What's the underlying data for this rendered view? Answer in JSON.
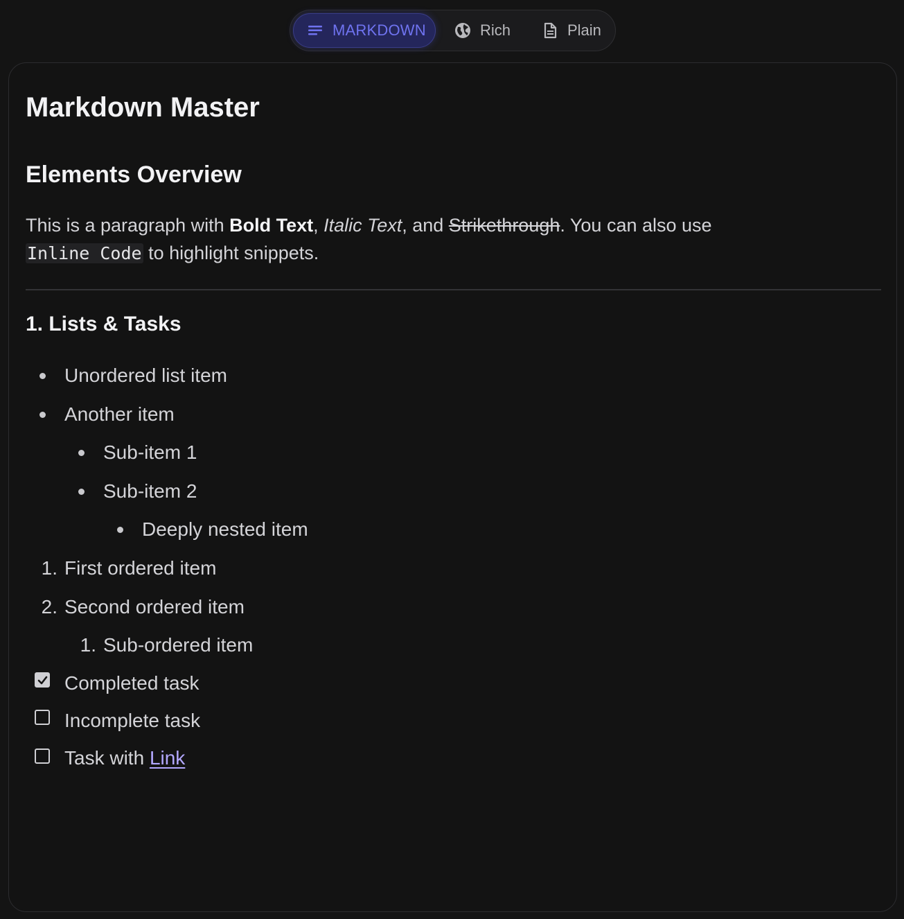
{
  "modes": {
    "markdown": {
      "label": "MARKDOWN",
      "icon": "lines-icon",
      "active": true
    },
    "rich": {
      "label": "Rich",
      "icon": "globe-icon"
    },
    "plain": {
      "label": "Plain",
      "icon": "document-icon"
    }
  },
  "doc": {
    "title": "Markdown Master",
    "section_title": "Elements Overview",
    "paragraph": {
      "p1": "This is a paragraph with ",
      "bold": "Bold Text",
      "p2": ", ",
      "italic": "Italic Text",
      "p3": ", and ",
      "strike": "Strikethrough",
      "p4": ". You can also use",
      "code": "Inline Code",
      "p5": " to highlight snippets."
    },
    "lists_title": "1. Lists & Tasks",
    "unordered": [
      "Unordered list item",
      "Another item",
      "Sub-item 1",
      "Sub-item 2",
      "Deeply nested item"
    ],
    "ordered": [
      {
        "num": "1.",
        "text": "First ordered item"
      },
      {
        "num": "2.",
        "text": "Second ordered item"
      },
      {
        "num": "1.",
        "text": "Sub-ordered item"
      }
    ],
    "tasks": [
      {
        "text": "Completed task",
        "checked": true
      },
      {
        "text": "Incomplete task",
        "checked": false
      },
      {
        "text": "Task with ",
        "link": "Link",
        "checked": false
      }
    ]
  },
  "colors": {
    "background": "#141414",
    "accent": "#6f73f0",
    "link": "#b3a8ff"
  }
}
